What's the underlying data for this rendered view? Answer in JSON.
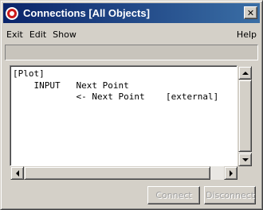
{
  "window": {
    "title": "Connections [All Objects]",
    "close_glyph": "✕",
    "title_bar_colors": [
      "#0a246a",
      "#3a6ea5"
    ]
  },
  "menu": {
    "exit": "Exit",
    "edit": "Edit",
    "show": "Show",
    "help": "Help"
  },
  "content": {
    "lines": [
      "[Plot]",
      "    INPUT   Next Point",
      "            <- Next Point    [external]"
    ]
  },
  "buttons": {
    "connect": "Connect",
    "disconnect": "Disconnect",
    "connect_enabled": false,
    "disconnect_enabled": false
  },
  "icons": {
    "app": "app-icon",
    "close": "close-icon",
    "scroll_up": "arrow-up-icon",
    "scroll_down": "arrow-down-icon",
    "scroll_left": "arrow-left-icon",
    "scroll_right": "arrow-right-icon"
  }
}
